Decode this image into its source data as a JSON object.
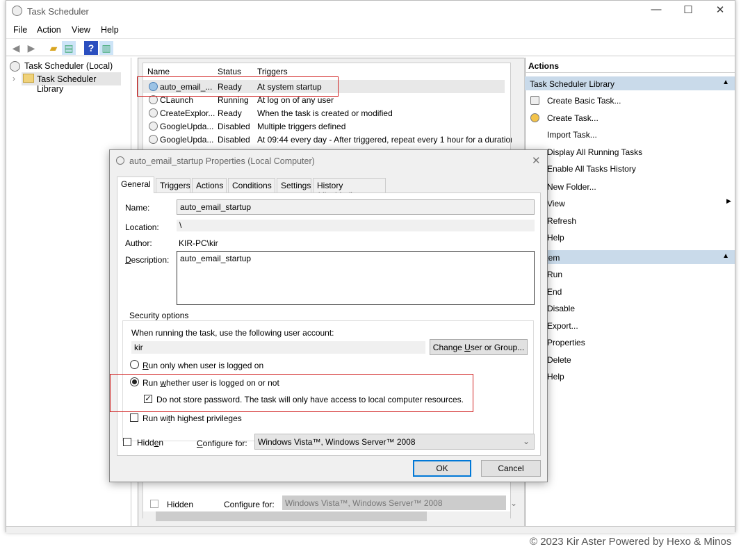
{
  "window": {
    "title": "Task Scheduler",
    "min": "—",
    "max": "☐",
    "close": "✕"
  },
  "menu": [
    "File",
    "Action",
    "View",
    "Help"
  ],
  "toolbar": {
    "icons": [
      "back-arrow-icon",
      "forward-arrow-icon",
      "up-folder-icon",
      "show-hide-tree-icon",
      "help-icon",
      "show-hide-action-pane-icon"
    ]
  },
  "tree": {
    "root": "Task Scheduler (Local)",
    "child": "Task Scheduler Library"
  },
  "list": {
    "columns": [
      "Name",
      "Status",
      "Triggers"
    ],
    "rows": [
      {
        "name": "auto_email_...",
        "status": "Ready",
        "trigger": "At system startup"
      },
      {
        "name": "CLaunch",
        "status": "Running",
        "trigger": "At log on of any user"
      },
      {
        "name": "CreateExplor...",
        "status": "Ready",
        "trigger": "When the task is created or modified"
      },
      {
        "name": "GoogleUpda...",
        "status": "Disabled",
        "trigger": "Multiple triggers defined"
      },
      {
        "name": "GoogleUpda...",
        "status": "Disabled",
        "trigger": "At 09:44 every day - After triggered, repeat every 1 hour for a duration"
      }
    ],
    "bg_hidden": "Hidden",
    "bg_configure": "Configure for:",
    "bg_configure_value": "Windows Vista™, Windows Server™ 2008"
  },
  "actions": {
    "header": "Actions",
    "section1": "Task Scheduler Library",
    "items1": [
      "Create Basic Task...",
      "Create Task...",
      "Import Task...",
      "Display All Running Tasks",
      "Enable All Tasks History",
      "New Folder...",
      "View",
      "Refresh",
      "Help"
    ],
    "section2": "ted Item",
    "items2": [
      "Run",
      "End",
      "Disable",
      "Export...",
      "Properties",
      "Delete",
      "Help"
    ]
  },
  "dialog": {
    "title": "auto_email_startup Properties (Local Computer)",
    "tabs": [
      "General",
      "Triggers",
      "Actions",
      "Conditions",
      "Settings",
      "History (disabled)"
    ],
    "name_label": "Name:",
    "name_value": "auto_email_startup",
    "location_label": "Location:",
    "location_value": "\\",
    "author_label": "Author:",
    "author_value": "KIR-PC\\kir",
    "description_label": "Description:",
    "description_value": "auto_email_startup",
    "security_legend": "Security options",
    "account_prompt": "When running the task, use the following user account:",
    "account_value": "kir",
    "change_user_button": "Change User or Group...",
    "radio_logged_on": "Run only when user is logged on",
    "radio_whether": "Run whether user is logged on or not",
    "selected_radio": "Run whether user is logged on or not",
    "no_store_password": "Do not store password.  The task will only have access to local computer resources.",
    "no_store_password_checked": true,
    "highest_privileges": "Run with highest privileges",
    "highest_privileges_checked": false,
    "hidden_label": "Hidden",
    "hidden_checked": false,
    "configure_label": "Configure for:",
    "configure_value": "Windows Vista™, Windows Server™ 2008",
    "ok": "OK",
    "cancel": "Cancel"
  },
  "background_footer": "© 2023 Kir Aster Powered by Hexo & Minos",
  "colors": {
    "highlight_box": "#d02020",
    "section_header": "#c9daea",
    "ok_border": "#0078d7"
  }
}
